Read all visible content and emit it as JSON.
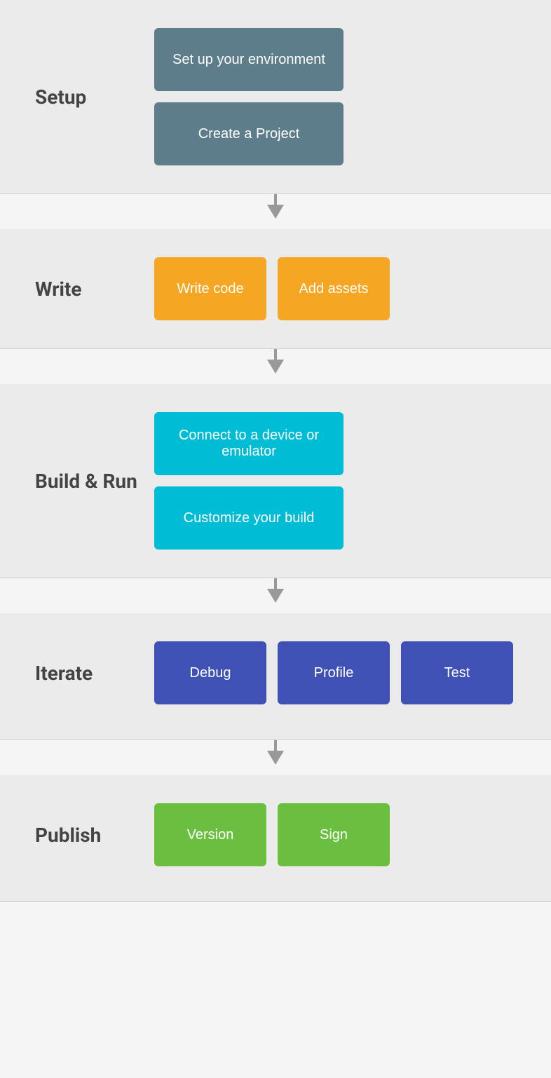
{
  "sections": {
    "setup": {
      "label": "Setup",
      "buttons": [
        {
          "id": "set-up-env",
          "text": "Set up your environment",
          "color": "btn-gray",
          "size": "btn-wide"
        },
        {
          "id": "create-project",
          "text": "Create a Project",
          "color": "btn-gray",
          "size": "btn-wide"
        }
      ]
    },
    "write": {
      "label": "Write",
      "buttons": [
        {
          "id": "write-code",
          "text": "Write code",
          "color": "btn-orange",
          "size": "btn-normal"
        },
        {
          "id": "add-assets",
          "text": "Add assets",
          "color": "btn-orange",
          "size": "btn-normal"
        }
      ]
    },
    "buildrun": {
      "label": "Build & Run",
      "buttons": [
        {
          "id": "connect-device",
          "text": "Connect to a device or emulator",
          "color": "btn-cyan",
          "size": "btn-wide"
        },
        {
          "id": "customize-build",
          "text": "Customize your build",
          "color": "btn-cyan",
          "size": "btn-wide"
        }
      ]
    },
    "iterate": {
      "label": "Iterate",
      "buttons": [
        {
          "id": "debug",
          "text": "Debug",
          "color": "btn-blue",
          "size": "btn-normal"
        },
        {
          "id": "profile",
          "text": "Profile",
          "color": "btn-blue",
          "size": "btn-normal"
        },
        {
          "id": "test",
          "text": "Test",
          "color": "btn-blue",
          "size": "btn-normal"
        }
      ]
    },
    "publish": {
      "label": "Publish",
      "buttons": [
        {
          "id": "version",
          "text": "Version",
          "color": "btn-green",
          "size": "btn-normal"
        },
        {
          "id": "sign",
          "text": "Sign",
          "color": "btn-green",
          "size": "btn-normal"
        }
      ]
    }
  }
}
